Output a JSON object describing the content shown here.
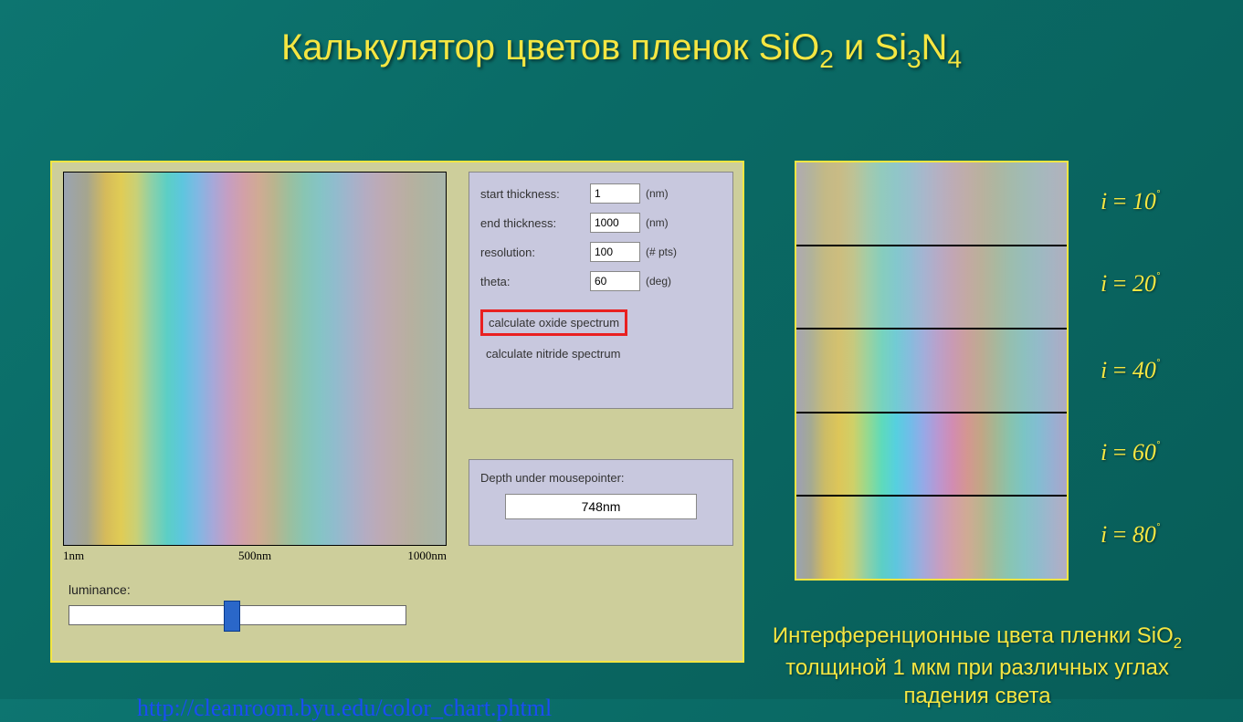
{
  "title": {
    "pre": "Калькулятор цветов пленок SiO",
    "sub1": "2",
    "mid": "  и Si",
    "sub2": "3",
    "n": "N",
    "sub3": "4"
  },
  "controls": {
    "start_thickness_label": "start thickness:",
    "start_thickness_value": "1",
    "start_thickness_unit": "(nm)",
    "end_thickness_label": "end thickness:",
    "end_thickness_value": "1000",
    "end_thickness_unit": "(nm)",
    "resolution_label": "resolution:",
    "resolution_value": "100",
    "resolution_unit": "(# pts)",
    "theta_label": "theta:",
    "theta_value": "60",
    "theta_unit": "(deg)",
    "btn_oxide": "calculate oxide spectrum",
    "btn_nitride": "calculate nitride spectrum"
  },
  "axis": {
    "tick1": "1nm",
    "tick2": "500nm",
    "tick3": "1000nm"
  },
  "depth": {
    "label": "Depth under mousepointer:",
    "value": "748nm"
  },
  "luminance_label": "luminance:",
  "url": "http://cleanroom.byu.edu/color_chart.phtml",
  "angles": {
    "a1": "10",
    "a2": "20",
    "a3": "40",
    "a4": "60",
    "a5": "80"
  },
  "caption": {
    "l1": "Интерференционные цвета пленки SiO",
    "sub": "2",
    "l2": " толщиной 1 мкм при различных углах падения света"
  }
}
